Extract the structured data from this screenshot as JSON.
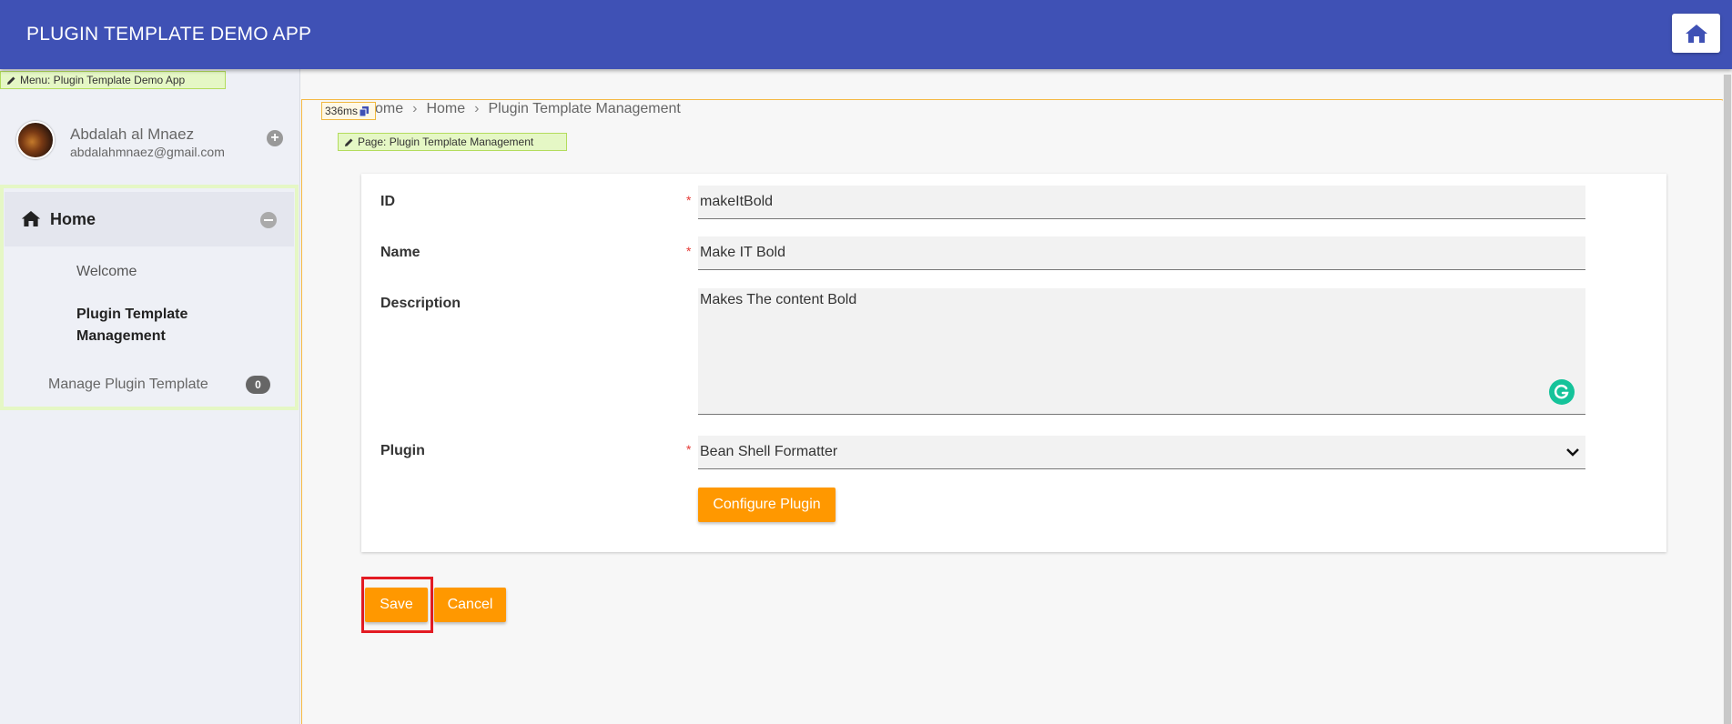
{
  "header": {
    "title": "PLUGIN TEMPLATE DEMO APP",
    "home_icon": "home-icon"
  },
  "sidebar": {
    "menu_tag": "Menu: Plugin Template Demo App",
    "user": {
      "name": "Abdalah al Mnaez",
      "email": "abdalahmnaez@gmail.com"
    },
    "category": "Home",
    "items": [
      {
        "label": "Welcome",
        "active": false
      },
      {
        "label": "Plugin Template Management",
        "active": true
      }
    ],
    "link": {
      "label": "Manage Plugin Template",
      "badge": "0"
    }
  },
  "page": {
    "timing": "336ms",
    "breadcrumb": [
      "ome",
      "Home",
      "Plugin Template Management"
    ],
    "page_tag": "Page: Plugin Template Management"
  },
  "form": {
    "id": {
      "label": "ID",
      "value": "makeItBold",
      "required": "*"
    },
    "name": {
      "label": "Name",
      "value": "Make IT Bold",
      "required": "*"
    },
    "description": {
      "label": "Description",
      "value": "Makes The content Bold"
    },
    "plugin": {
      "label": "Plugin",
      "value": "Bean Shell Formatter",
      "required": "*"
    },
    "configure_label": "Configure Plugin"
  },
  "actions": {
    "save": "Save",
    "cancel": "Cancel"
  },
  "colors": {
    "primary": "#3f51b5",
    "accent": "#ff9800",
    "highlight": "#e31b23"
  }
}
